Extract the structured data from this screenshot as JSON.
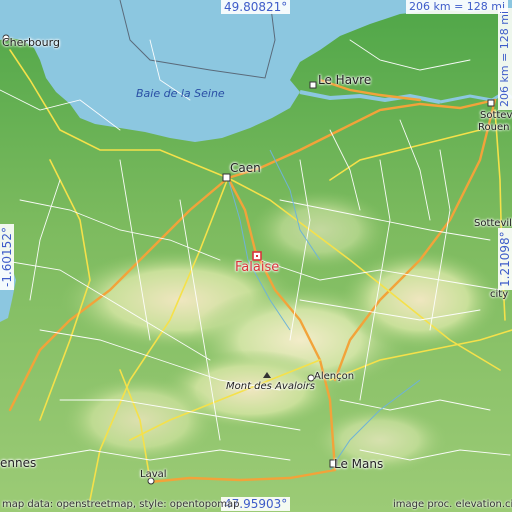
{
  "coordinates": {
    "top": "49.80821°",
    "bottom": "47.95903°",
    "left": "-1.60152°",
    "right": "1.21098°",
    "scale_horizontal": "206 km = 128 mi",
    "scale_vertical": "206 km = 128 mi"
  },
  "water_bodies": {
    "bay": "Baie de la Seine"
  },
  "places": {
    "target": "Falaise",
    "caen": "Caen",
    "le_havre": "Le Havre",
    "cherbourg": "Cherbourg",
    "rouen": "Rouen",
    "sotteville": "Sotteville-lès-Rouen",
    "sotteville_short": "Sotteville-lè",
    "rouen_short": "Rouen",
    "sotteville_tail": "Sotteville-lès-Rouen",
    "alencon": "Alençon",
    "le_mans": "Le Mans",
    "laval": "Laval",
    "rennes": "ennes",
    "city_right": "city"
  },
  "pois": {
    "mont_des_avaloirs": "Mont des Avaloirs"
  },
  "attribution": {
    "left": "map data: openstreetmap, style: opentopomap",
    "right": "image proc. elevation.city"
  },
  "colors": {
    "sea": "#8cc7e0",
    "lowland": "#5fb44e",
    "mid": "#b8d98f",
    "highland": "#e8e2b4",
    "motorway": "#f2a33a",
    "primary": "#f5e14a",
    "road": "#ffffff",
    "marker": "#d9343a",
    "coord_text": "#3e5cc9"
  }
}
